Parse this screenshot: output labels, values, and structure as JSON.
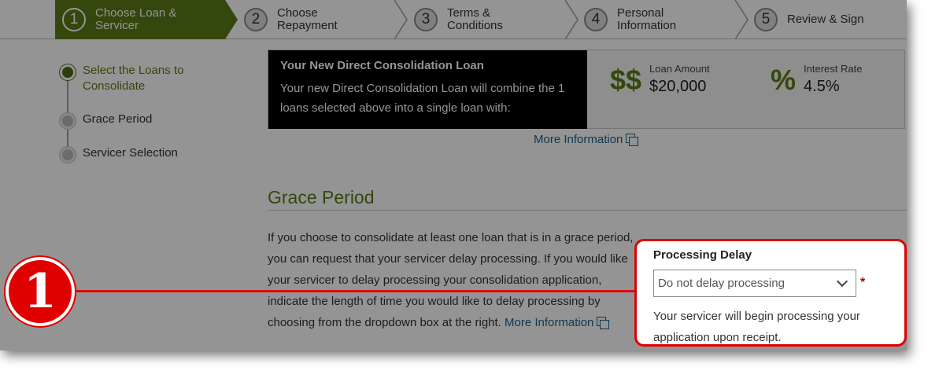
{
  "stepper": {
    "steps": [
      {
        "num": "1",
        "label": "Choose Loan & Servicer"
      },
      {
        "num": "2",
        "label": "Choose Repayment"
      },
      {
        "num": "3",
        "label": "Terms & Conditions"
      },
      {
        "num": "4",
        "label": "Personal Information"
      },
      {
        "num": "5",
        "label": "Review & Sign"
      }
    ]
  },
  "sidenav": {
    "items": [
      {
        "label": "Select the Loans to Consolidate"
      },
      {
        "label": "Grace Period"
      },
      {
        "label": "Servicer Selection"
      }
    ]
  },
  "summary": {
    "title": "Your New Direct Consolidation Loan",
    "description": "Your new Direct Consolidation Loan will combine the 1 loans selected above into a single loan with:",
    "loan_amount_label": "Loan Amount",
    "loan_amount_value": "$20,000",
    "loan_amount_icon": "$$",
    "interest_rate_label": "Interest Rate",
    "interest_rate_value": "4.5%",
    "interest_rate_icon": "%"
  },
  "more_info_label": "More Information",
  "grace_period": {
    "title": "Grace Period",
    "body": "If you choose to consolidate at least one loan that is in a grace period, you can request that your servicer delay processing. If you would like your servicer to delay processing your consolidation application, indicate the length of time you would like to delay processing by choosing from the dropdown box at the right.",
    "more_info_label": "More Information"
  },
  "processing_delay": {
    "label": "Processing Delay",
    "selected": "Do not delay processing",
    "required_mark": "*",
    "help_text": "Your servicer will begin processing your application upon receipt."
  },
  "annotation": {
    "badge_number": "1",
    "color": "#e00000"
  },
  "colors": {
    "accent_green": "#5a7a16",
    "link_blue": "#1f5f8b"
  }
}
